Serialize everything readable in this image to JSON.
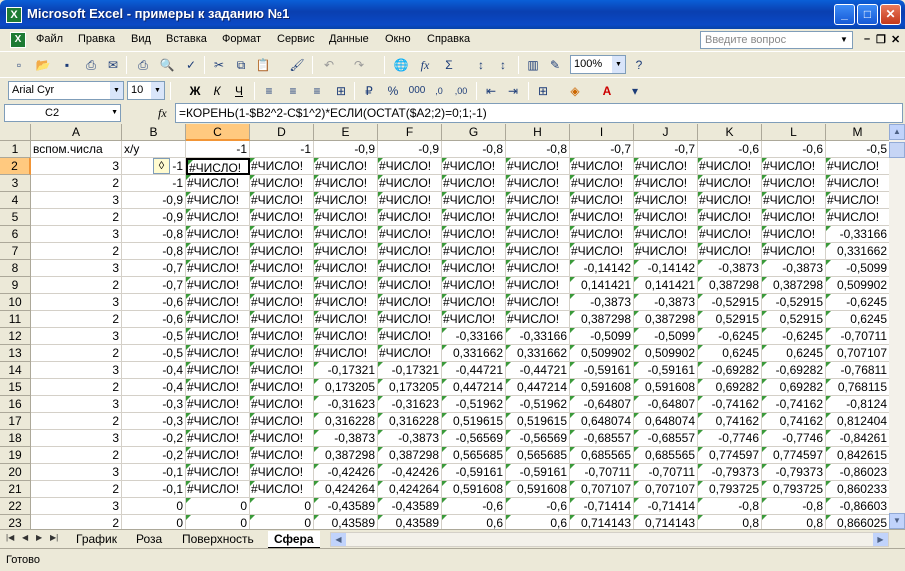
{
  "window": {
    "title": "Microsoft Excel - примеры к заданию  №1",
    "min_label": "_",
    "max_label": "□",
    "close_label": "✕"
  },
  "menu": {
    "items": [
      "Файл",
      "Правка",
      "Вид",
      "Вставка",
      "Формат",
      "Сервис",
      "Данные",
      "Окно",
      "Справка"
    ],
    "help_placeholder": "Введите вопрос",
    "doc_min": "–",
    "doc_restore": "❐",
    "doc_close": "✕"
  },
  "toolbar": {
    "zoom": "100%",
    "font": "Arial Cyr",
    "font_size": "10",
    "bold": "Ж",
    "italic": "К",
    "underline": "Ч"
  },
  "formula_bar": {
    "name_box": "C2",
    "fx": "fx",
    "formula": "=КОРЕНЬ(1-$B2^2-C$1^2)*ЕСЛИ(ОСТАТ($A2;2)=0;1;-1)"
  },
  "sheet": {
    "columns": [
      "A",
      "B",
      "C",
      "D",
      "E",
      "F",
      "G",
      "H",
      "I",
      "J",
      "K",
      "L",
      "M"
    ],
    "selected_cell": "C2",
    "rows": [
      [
        "1",
        [
          "вспом.числа",
          "x/y",
          "-1",
          "-1",
          "-0,9",
          "-0,9",
          "-0,8",
          "-0,8",
          "-0,7",
          "-0,7",
          "-0,6",
          "-0,6",
          "-0,5"
        ]
      ],
      [
        "2",
        [
          "3",
          "-1",
          "#ЧИСЛО!",
          "#ЧИСЛО!",
          "#ЧИСЛО!",
          "#ЧИСЛО!",
          "#ЧИСЛО!",
          "#ЧИСЛО!",
          "#ЧИСЛО!",
          "#ЧИСЛО!",
          "#ЧИСЛО!",
          "#ЧИСЛО!",
          "#ЧИСЛО!"
        ]
      ],
      [
        "3",
        [
          "2",
          "-1",
          "#ЧИСЛО!",
          "#ЧИСЛО!",
          "#ЧИСЛО!",
          "#ЧИСЛО!",
          "#ЧИСЛО!",
          "#ЧИСЛО!",
          "#ЧИСЛО!",
          "#ЧИСЛО!",
          "#ЧИСЛО!",
          "#ЧИСЛО!",
          "#ЧИСЛО!"
        ]
      ],
      [
        "4",
        [
          "3",
          "-0,9",
          "#ЧИСЛО!",
          "#ЧИСЛО!",
          "#ЧИСЛО!",
          "#ЧИСЛО!",
          "#ЧИСЛО!",
          "#ЧИСЛО!",
          "#ЧИСЛО!",
          "#ЧИСЛО!",
          "#ЧИСЛО!",
          "#ЧИСЛО!",
          "#ЧИСЛО!"
        ]
      ],
      [
        "5",
        [
          "2",
          "-0,9",
          "#ЧИСЛО!",
          "#ЧИСЛО!",
          "#ЧИСЛО!",
          "#ЧИСЛО!",
          "#ЧИСЛО!",
          "#ЧИСЛО!",
          "#ЧИСЛО!",
          "#ЧИСЛО!",
          "#ЧИСЛО!",
          "#ЧИСЛО!",
          "#ЧИСЛО!"
        ]
      ],
      [
        "6",
        [
          "3",
          "-0,8",
          "#ЧИСЛО!",
          "#ЧИСЛО!",
          "#ЧИСЛО!",
          "#ЧИСЛО!",
          "#ЧИСЛО!",
          "#ЧИСЛО!",
          "#ЧИСЛО!",
          "#ЧИСЛО!",
          "#ЧИСЛО!",
          "#ЧИСЛО!",
          "-0,33166"
        ]
      ],
      [
        "7",
        [
          "2",
          "-0,8",
          "#ЧИСЛО!",
          "#ЧИСЛО!",
          "#ЧИСЛО!",
          "#ЧИСЛО!",
          "#ЧИСЛО!",
          "#ЧИСЛО!",
          "#ЧИСЛО!",
          "#ЧИСЛО!",
          "#ЧИСЛО!",
          "#ЧИСЛО!",
          "0,331662"
        ]
      ],
      [
        "8",
        [
          "3",
          "-0,7",
          "#ЧИСЛО!",
          "#ЧИСЛО!",
          "#ЧИСЛО!",
          "#ЧИСЛО!",
          "#ЧИСЛО!",
          "#ЧИСЛО!",
          "-0,14142",
          "-0,14142",
          "-0,3873",
          "-0,3873",
          "-0,5099"
        ]
      ],
      [
        "9",
        [
          "2",
          "-0,7",
          "#ЧИСЛО!",
          "#ЧИСЛО!",
          "#ЧИСЛО!",
          "#ЧИСЛО!",
          "#ЧИСЛО!",
          "#ЧИСЛО!",
          "0,141421",
          "0,141421",
          "0,387298",
          "0,387298",
          "0,509902"
        ]
      ],
      [
        "10",
        [
          "3",
          "-0,6",
          "#ЧИСЛО!",
          "#ЧИСЛО!",
          "#ЧИСЛО!",
          "#ЧИСЛО!",
          "#ЧИСЛО!",
          "#ЧИСЛО!",
          "-0,3873",
          "-0,3873",
          "-0,52915",
          "-0,52915",
          "-0,6245"
        ]
      ],
      [
        "11",
        [
          "2",
          "-0,6",
          "#ЧИСЛО!",
          "#ЧИСЛО!",
          "#ЧИСЛО!",
          "#ЧИСЛО!",
          "#ЧИСЛО!",
          "#ЧИСЛО!",
          "0,387298",
          "0,387298",
          "0,52915",
          "0,52915",
          "0,6245"
        ]
      ],
      [
        "12",
        [
          "3",
          "-0,5",
          "#ЧИСЛО!",
          "#ЧИСЛО!",
          "#ЧИСЛО!",
          "#ЧИСЛО!",
          "-0,33166",
          "-0,33166",
          "-0,5099",
          "-0,5099",
          "-0,6245",
          "-0,6245",
          "-0,70711"
        ]
      ],
      [
        "13",
        [
          "2",
          "-0,5",
          "#ЧИСЛО!",
          "#ЧИСЛО!",
          "#ЧИСЛО!",
          "#ЧИСЛО!",
          "0,331662",
          "0,331662",
          "0,509902",
          "0,509902",
          "0,6245",
          "0,6245",
          "0,707107"
        ]
      ],
      [
        "14",
        [
          "3",
          "-0,4",
          "#ЧИСЛО!",
          "#ЧИСЛО!",
          "-0,17321",
          "-0,17321",
          "-0,44721",
          "-0,44721",
          "-0,59161",
          "-0,59161",
          "-0,69282",
          "-0,69282",
          "-0,76811"
        ]
      ],
      [
        "15",
        [
          "2",
          "-0,4",
          "#ЧИСЛО!",
          "#ЧИСЛО!",
          "0,173205",
          "0,173205",
          "0,447214",
          "0,447214",
          "0,591608",
          "0,591608",
          "0,69282",
          "0,69282",
          "0,768115"
        ]
      ],
      [
        "16",
        [
          "3",
          "-0,3",
          "#ЧИСЛО!",
          "#ЧИСЛО!",
          "-0,31623",
          "-0,31623",
          "-0,51962",
          "-0,51962",
          "-0,64807",
          "-0,64807",
          "-0,74162",
          "-0,74162",
          "-0,8124"
        ]
      ],
      [
        "17",
        [
          "2",
          "-0,3",
          "#ЧИСЛО!",
          "#ЧИСЛО!",
          "0,316228",
          "0,316228",
          "0,519615",
          "0,519615",
          "0,648074",
          "0,648074",
          "0,74162",
          "0,74162",
          "0,812404"
        ]
      ],
      [
        "18",
        [
          "3",
          "-0,2",
          "#ЧИСЛО!",
          "#ЧИСЛО!",
          "-0,3873",
          "-0,3873",
          "-0,56569",
          "-0,56569",
          "-0,68557",
          "-0,68557",
          "-0,7746",
          "-0,7746",
          "-0,84261"
        ]
      ],
      [
        "19",
        [
          "2",
          "-0,2",
          "#ЧИСЛО!",
          "#ЧИСЛО!",
          "0,387298",
          "0,387298",
          "0,565685",
          "0,565685",
          "0,685565",
          "0,685565",
          "0,774597",
          "0,774597",
          "0,842615"
        ]
      ],
      [
        "20",
        [
          "3",
          "-0,1",
          "#ЧИСЛО!",
          "#ЧИСЛО!",
          "-0,42426",
          "-0,42426",
          "-0,59161",
          "-0,59161",
          "-0,70711",
          "-0,70711",
          "-0,79373",
          "-0,79373",
          "-0,86023"
        ]
      ],
      [
        "21",
        [
          "2",
          "-0,1",
          "#ЧИСЛО!",
          "#ЧИСЛО!",
          "0,424264",
          "0,424264",
          "0,591608",
          "0,591608",
          "0,707107",
          "0,707107",
          "0,793725",
          "0,793725",
          "0,860233"
        ]
      ],
      [
        "22",
        [
          "3",
          "0",
          "0",
          "0",
          "-0,43589",
          "-0,43589",
          "-0,6",
          "-0,6",
          "-0,71414",
          "-0,71414",
          "-0,8",
          "-0,8",
          "-0,86603"
        ]
      ],
      [
        "23",
        [
          "2",
          "0",
          "0",
          "0",
          "0,43589",
          "0,43589",
          "0,6",
          "0,6",
          "0,714143",
          "0,714143",
          "0,8",
          "0,8",
          "0,866025"
        ]
      ]
    ]
  },
  "tabs": [
    "График",
    "Роза",
    "Поверхность",
    "Сфера"
  ],
  "active_tab": "Сфера",
  "status": "Готово"
}
